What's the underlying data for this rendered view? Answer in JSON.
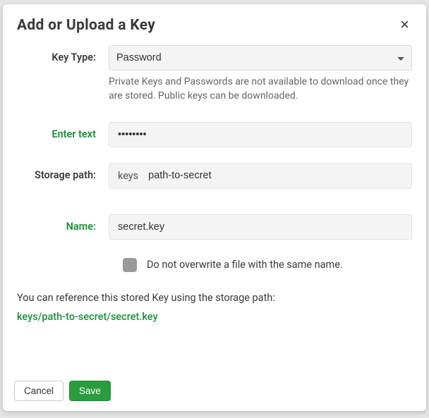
{
  "modal": {
    "title": "Add or Upload a Key",
    "close_glyph": "×"
  },
  "fields": {
    "key_type": {
      "label": "Key Type:",
      "value": "Password",
      "help": "Private Keys and Passwords are not available to download once they are stored. Public keys can be downloaded."
    },
    "enter_text": {
      "label": "Enter text",
      "value": "••••••••"
    },
    "storage_path": {
      "label": "Storage path:",
      "prefix": "keys",
      "value": "path-to-secret"
    },
    "name": {
      "label": "Name:",
      "value": "secret.key"
    },
    "overwrite": {
      "label": "Do not overwrite a file with the same name."
    }
  },
  "reference": {
    "intro": "You can reference this stored Key using the storage path:",
    "path": "keys/path-to-secret/secret.key"
  },
  "footer": {
    "cancel": "Cancel",
    "save": "Save"
  }
}
